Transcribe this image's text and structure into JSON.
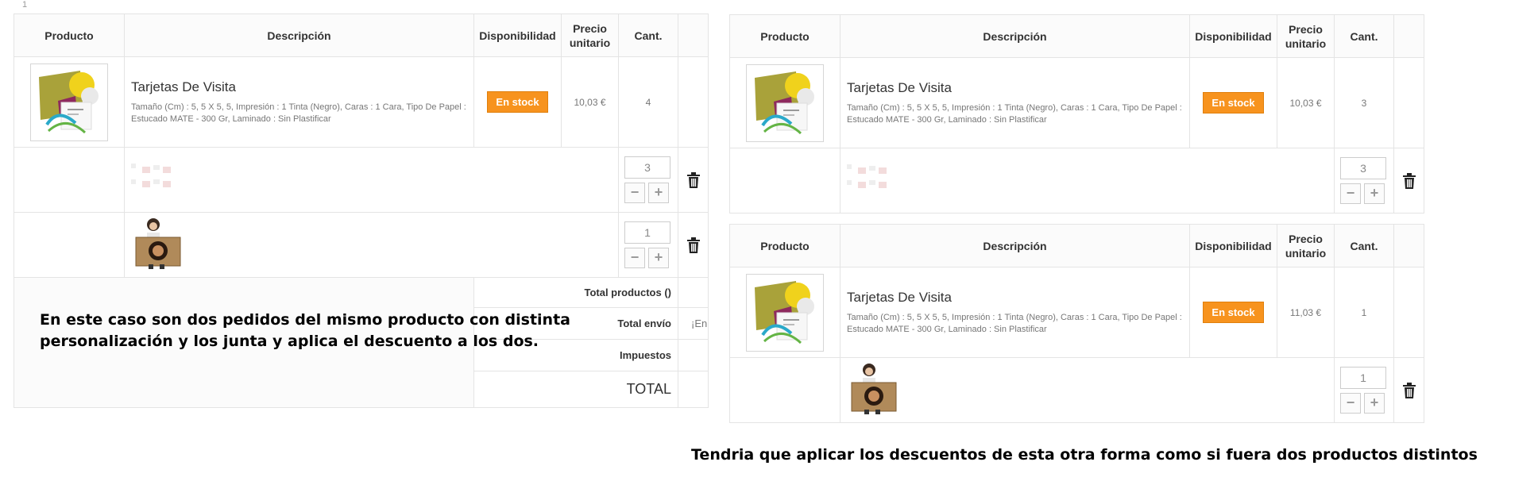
{
  "marker": "1",
  "headers": {
    "producto": "Producto",
    "descripcion": "Descripción",
    "disponibilidad": "Disponibilidad",
    "precio_line1": "Precio",
    "precio_line2": "unitario",
    "cant": "Cant."
  },
  "left_table": {
    "product": {
      "name": "Tarjetas De Visita",
      "desc": "Tamaño (Cm) : 5, 5 X 5, 5, Impresión : 1 Tinta (Negro), Caras : 1 Cara, Tipo De Papel : Estucado MATE - 300 Gr, Laminado : Sin Plastificar",
      "stock": "En stock",
      "price": "10,03 €",
      "qty": "4"
    },
    "custom_rows": [
      {
        "qty": "3"
      },
      {
        "qty": "1"
      }
    ],
    "totals": {
      "productos_label": "Total productos ()",
      "envio_label": "Total envío",
      "envio_value": "¡En",
      "impuestos_label": "Impuestos",
      "total_label": "TOTAL"
    }
  },
  "right_table_1": {
    "product": {
      "name": "Tarjetas De Visita",
      "desc": "Tamaño (Cm) : 5, 5 X 5, 5, Impresión : 1 Tinta (Negro), Caras : 1 Cara, Tipo De Papel : Estucado MATE - 300 Gr, Laminado : Sin Plastificar",
      "stock": "En stock",
      "price": "10,03 €",
      "qty": "3"
    },
    "custom_rows": [
      {
        "qty": "3"
      }
    ]
  },
  "right_table_2": {
    "product": {
      "name": "Tarjetas De Visita",
      "desc": "Tamaño (Cm) : 5, 5 X 5, 5, Impresión : 1 Tinta (Negro), Caras : 1 Cara, Tipo De Papel : Estucado MATE - 300 Gr, Laminado : Sin Plastificar",
      "stock": "En stock",
      "price": "11,03 €",
      "qty": "1"
    },
    "custom_rows": [
      {
        "qty": "1"
      }
    ]
  },
  "qty_controls": {
    "minus": "−",
    "plus": "+"
  },
  "notes": {
    "left": "En este caso son dos pedidos del mismo producto con distinta personalización y los junta y aplica el descuento a los dos.",
    "right": "Tendria que aplicar los descuentos de esta otra forma como si fuera dos productos distintos"
  },
  "icons": [
    "product-thumbnail",
    "custom-design-thumbnail",
    "custom-photo-thumbnail",
    "trash-icon"
  ],
  "colors": {
    "stock_badge": "#f7931e",
    "border": "#e4e4e4",
    "header_bg": "#fbfbfb"
  }
}
